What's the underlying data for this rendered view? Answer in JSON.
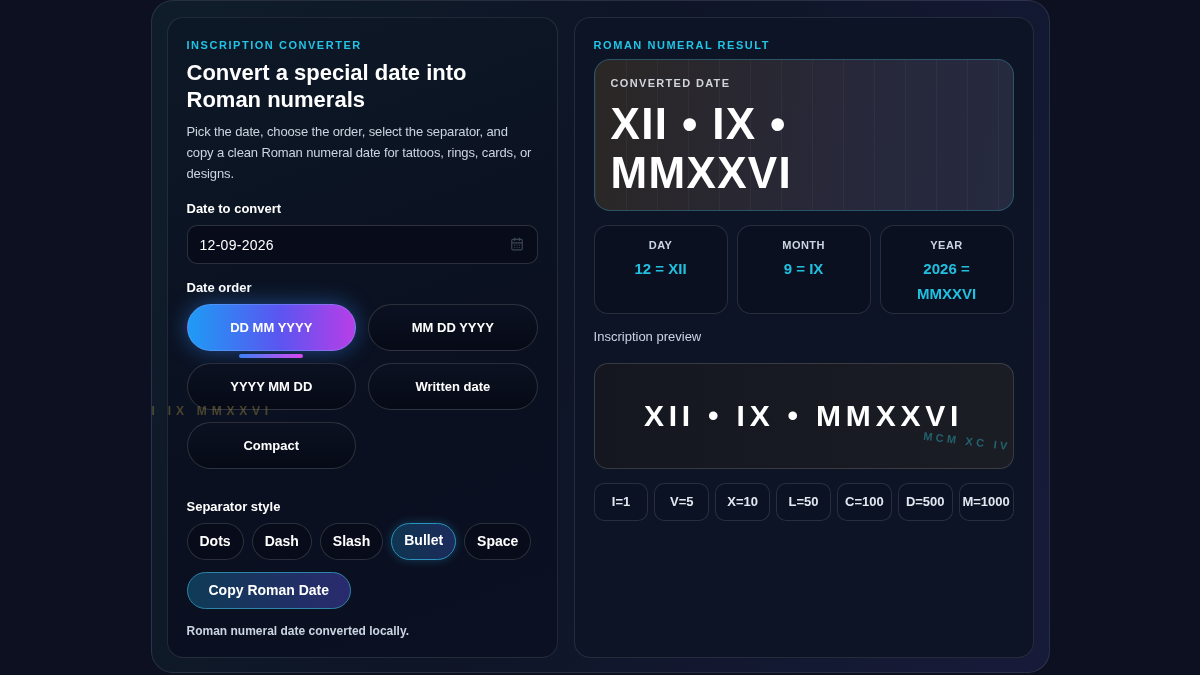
{
  "converter": {
    "eyebrow": "INSCRIPTION CONVERTER",
    "title": "Convert a special date into Roman numerals",
    "description": "Pick the date, choose the order, select the separator, and copy a clean Roman numeral date for tattoos, rings, cards, or designs.",
    "date_field": {
      "label": "Date to convert",
      "value": "12-09-2026"
    },
    "date_order": {
      "label": "Date order",
      "options": [
        {
          "label": "DD MM YYYY",
          "selected": true
        },
        {
          "label": "MM DD YYYY",
          "selected": false
        },
        {
          "label": "YYYY MM DD",
          "selected": false
        },
        {
          "label": "Written date",
          "selected": false
        },
        {
          "label": "Compact",
          "selected": false
        }
      ]
    },
    "separator": {
      "label": "Separator style",
      "options": [
        {
          "label": "Dots",
          "selected": false
        },
        {
          "label": "Dash",
          "selected": false
        },
        {
          "label": "Slash",
          "selected": false
        },
        {
          "label": "Bullet",
          "selected": true
        },
        {
          "label": "Space",
          "selected": false
        }
      ]
    },
    "copy_button": "Copy Roman Date",
    "status": "Roman numeral date converted locally."
  },
  "result": {
    "eyebrow": "ROMAN NUMERAL RESULT",
    "converted": {
      "label": "CONVERTED DATE",
      "value": "XII • IX • MMXXVI"
    },
    "breakdown": [
      {
        "label": "DAY",
        "value": "12 = XII"
      },
      {
        "label": "MONTH",
        "value": "9 = IX"
      },
      {
        "label": "YEAR",
        "value": "2026 = MMXXVI"
      }
    ],
    "preview": {
      "label": "Inscription preview",
      "value": "XII • IX • MMXXVI"
    },
    "legend": [
      "I=1",
      "V=5",
      "X=10",
      "L=50",
      "C=100",
      "D=500",
      "M=1000"
    ]
  },
  "background_marks": [
    "I IX MMXXVI",
    "MCM XC IV"
  ]
}
